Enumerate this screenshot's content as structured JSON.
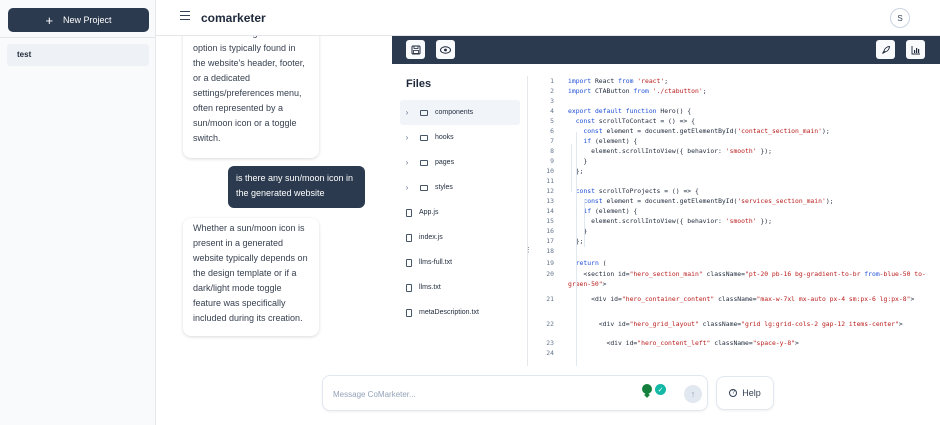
{
  "sidebar": {
    "new_project_label": "New Project",
    "projects": [
      "test"
    ]
  },
  "header": {
    "title": "comarketer",
    "avatar_initial": "S"
  },
  "chat": {
    "ai_message_1": "The dark and light mode option is typically found in the website's header, footer, or a dedicated settings/preferences menu, often represented by a sun/moon icon or a toggle switch.",
    "user_message": "is there any sun/moon icon in the generated website",
    "ai_message_2": "Whether a sun/moon icon is present in a generated website typically depends on the design template or if a dark/light mode toggle feature was specifically included during its creation."
  },
  "input": {
    "placeholder": "Message CoMarketer...",
    "help_label": "Help"
  },
  "panel": {
    "files_title": "Files",
    "tree": [
      {
        "name": "components",
        "type": "folder",
        "active": true
      },
      {
        "name": "hooks",
        "type": "folder"
      },
      {
        "name": "pages",
        "type": "folder"
      },
      {
        "name": "styles",
        "type": "folder"
      },
      {
        "name": "App.js",
        "type": "file"
      },
      {
        "name": "index.js",
        "type": "file"
      },
      {
        "name": "llms-full.txt",
        "type": "file"
      },
      {
        "name": "llms.txt",
        "type": "file"
      },
      {
        "name": "metaDescription.txt",
        "type": "file"
      }
    ],
    "code_lines": [
      {
        "n": "1",
        "t": "import React from 'react';"
      },
      {
        "n": "2",
        "t": "import CTAButton from './ctabutton';"
      },
      {
        "n": "3",
        "t": ""
      },
      {
        "n": "4",
        "t": "export default function Hero() {"
      },
      {
        "n": "5",
        "t": "  const scrollToContact = () => {"
      },
      {
        "n": "6",
        "t": "    const element = document.getElementById('contact_section_main');"
      },
      {
        "n": "7",
        "t": "    if (element) {"
      },
      {
        "n": "8",
        "t": "      element.scrollIntoView({ behavior: 'smooth' });"
      },
      {
        "n": "9",
        "t": "    }"
      },
      {
        "n": "10",
        "t": "  };"
      },
      {
        "n": "11",
        "t": ""
      },
      {
        "n": "12",
        "t": "  const scrollToProjects = () => {"
      },
      {
        "n": "13",
        "t": "    const element = document.getElementById('services_section_main');"
      },
      {
        "n": "14",
        "t": "    if (element) {"
      },
      {
        "n": "15",
        "t": "      element.scrollIntoView({ behavior: 'smooth' });"
      },
      {
        "n": "16",
        "t": "    }"
      },
      {
        "n": "17",
        "t": "  };"
      },
      {
        "n": "18",
        "t": ""
      },
      {
        "n": "19",
        "t": "  return ("
      },
      {
        "n": "20",
        "t": "    <section id=\"hero_section_main\" className=\"pt-20 pb-16 bg-gradient-to-br from-blue-50 to-green-50\">"
      },
      {
        "n": "21",
        "t": "      <div id=\"hero_container_content\" className=\"max-w-7xl mx-auto px-4 sm:px-6 lg:px-8\">"
      },
      {
        "n": "22",
        "t": "        <div id=\"hero_grid_layout\" className=\"grid lg:grid-cols-2 gap-12 items-center\">"
      },
      {
        "n": "23",
        "t": "          <div id=\"hero_content_left\" className=\"space-y-8\">"
      },
      {
        "n": "24",
        "t": ""
      }
    ]
  }
}
